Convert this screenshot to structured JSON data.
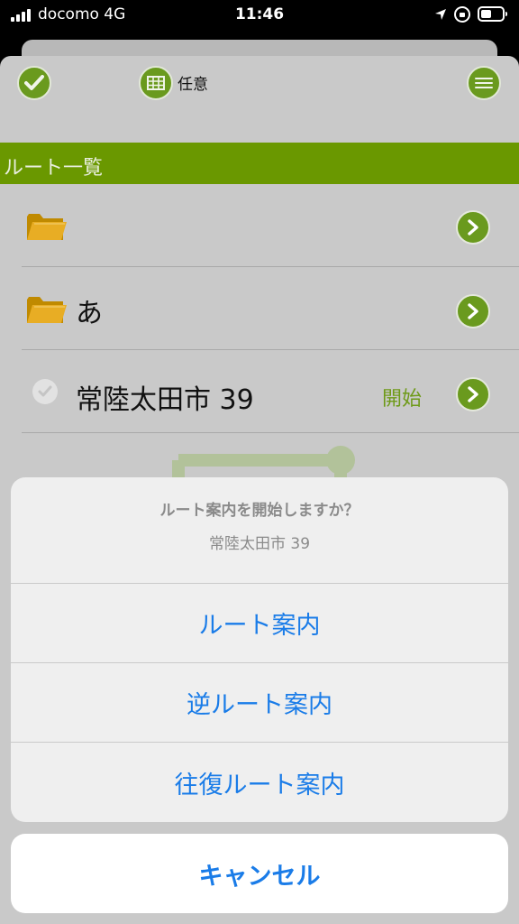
{
  "status_bar": {
    "carrier": "docomo   4G",
    "time": "11:46"
  },
  "header": {
    "view_label": "任意",
    "icons": {
      "done": "check-icon",
      "view": "grid-icon",
      "menu": "hamburger-menu-icon"
    }
  },
  "section": {
    "title": "ルート一覧"
  },
  "rows": [
    {
      "label": "",
      "icon": "folder-icon"
    },
    {
      "label": "あ",
      "icon": "folder-icon"
    },
    {
      "label": "常陸太田市 39",
      "icon": "check-icon",
      "start_label": "開始"
    }
  ],
  "action_sheet": {
    "title": "ルート案内を開始しますか？",
    "message": "常陸太田市 39",
    "actions": [
      "ルート案内",
      "逆ルート案内",
      "往復ルート案内"
    ],
    "cancel": "キャンセル"
  },
  "colors": {
    "accent_green": "#6a9a1e",
    "header_green": "#6a9800",
    "action_blue": "#1a7ce8"
  }
}
